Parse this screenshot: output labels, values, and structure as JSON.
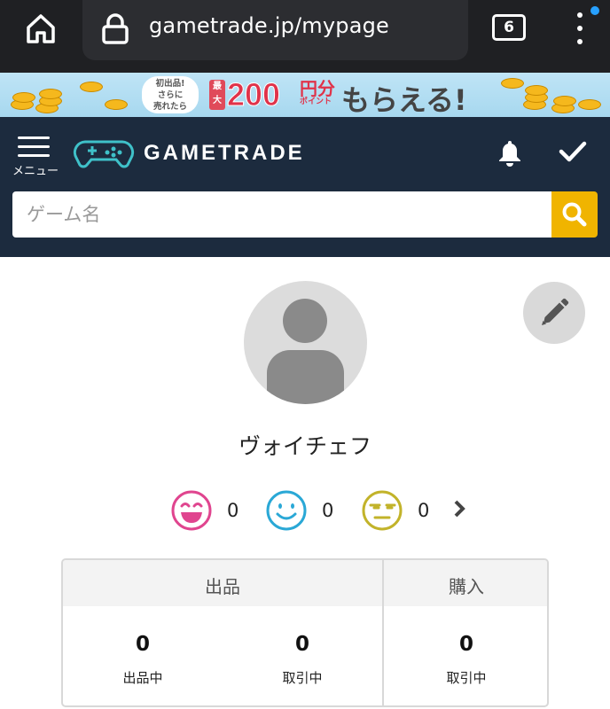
{
  "browser": {
    "url": "gametrade.jp/mypage",
    "tab_count": "6"
  },
  "banner": {
    "small_text_1": "初出品!",
    "small_text_2": "さらに",
    "small_text_3": "売れたら",
    "prefix": "最大",
    "amount": "200",
    "unit": "円分",
    "unit_sub": "ポイント",
    "main": "もらえる!"
  },
  "header": {
    "menu_label": "メニュー",
    "logo_text": "GAMETRADE",
    "search_placeholder": "ゲーム名"
  },
  "profile": {
    "username": "ヴォイチェフ",
    "ratings": [
      {
        "icon": "laughing-face-icon",
        "color": "#e0458f",
        "count": "0"
      },
      {
        "icon": "smiling-face-icon",
        "color": "#2aa8d6",
        "count": "0"
      },
      {
        "icon": "unamused-face-icon",
        "color": "#c2b32a",
        "count": "0"
      }
    ]
  },
  "stats": {
    "sell_header": "出品",
    "buy_header": "購入",
    "listing_count": "0",
    "listing_label": "出品中",
    "sell_trading_count": "0",
    "sell_trading_label": "取引中",
    "buy_trading_count": "0",
    "buy_trading_label": "取引中"
  },
  "colors": {
    "header_bg": "#1c2b3e",
    "search_accent": "#f0b400",
    "browser_bg": "#1f2023"
  }
}
